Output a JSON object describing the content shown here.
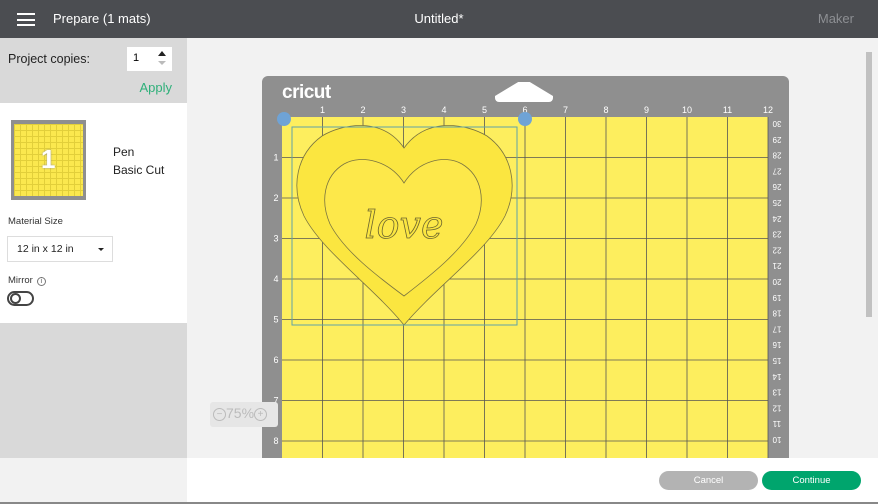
{
  "header": {
    "title": "Prepare (1 mats)",
    "document": "Untitled*",
    "machine": "Maker"
  },
  "sidebar": {
    "copies_label": "Project copies:",
    "copies_value": "1",
    "apply": "Apply",
    "mat": {
      "number": "1",
      "tool": "Pen",
      "mode": "Basic Cut"
    },
    "material_size_label": "Material Size",
    "material_size": "12 in x 12 in",
    "mirror_label": "Mirror",
    "mirror_on": false
  },
  "mat": {
    "brand": "cricut",
    "columns": [
      "1",
      "2",
      "3",
      "4",
      "5",
      "6",
      "7",
      "8",
      "9",
      "10",
      "11",
      "12"
    ],
    "rows": [
      "1",
      "2",
      "3",
      "4",
      "5",
      "6",
      "7",
      "8"
    ],
    "cm": [
      "30",
      "29",
      "28",
      "27",
      "26",
      "25",
      "24",
      "23",
      "22",
      "21",
      "20",
      "19",
      "18",
      "17",
      "16",
      "15",
      "14",
      "13",
      "12",
      "11",
      "10"
    ],
    "design_text": "love",
    "colors": {
      "mat": "#fdee5e",
      "frame": "#8f8f8f",
      "design": "#fbe640"
    }
  },
  "zoom": {
    "level": "75%"
  },
  "footer": {
    "cancel": "Cancel",
    "continue": "Continue"
  }
}
